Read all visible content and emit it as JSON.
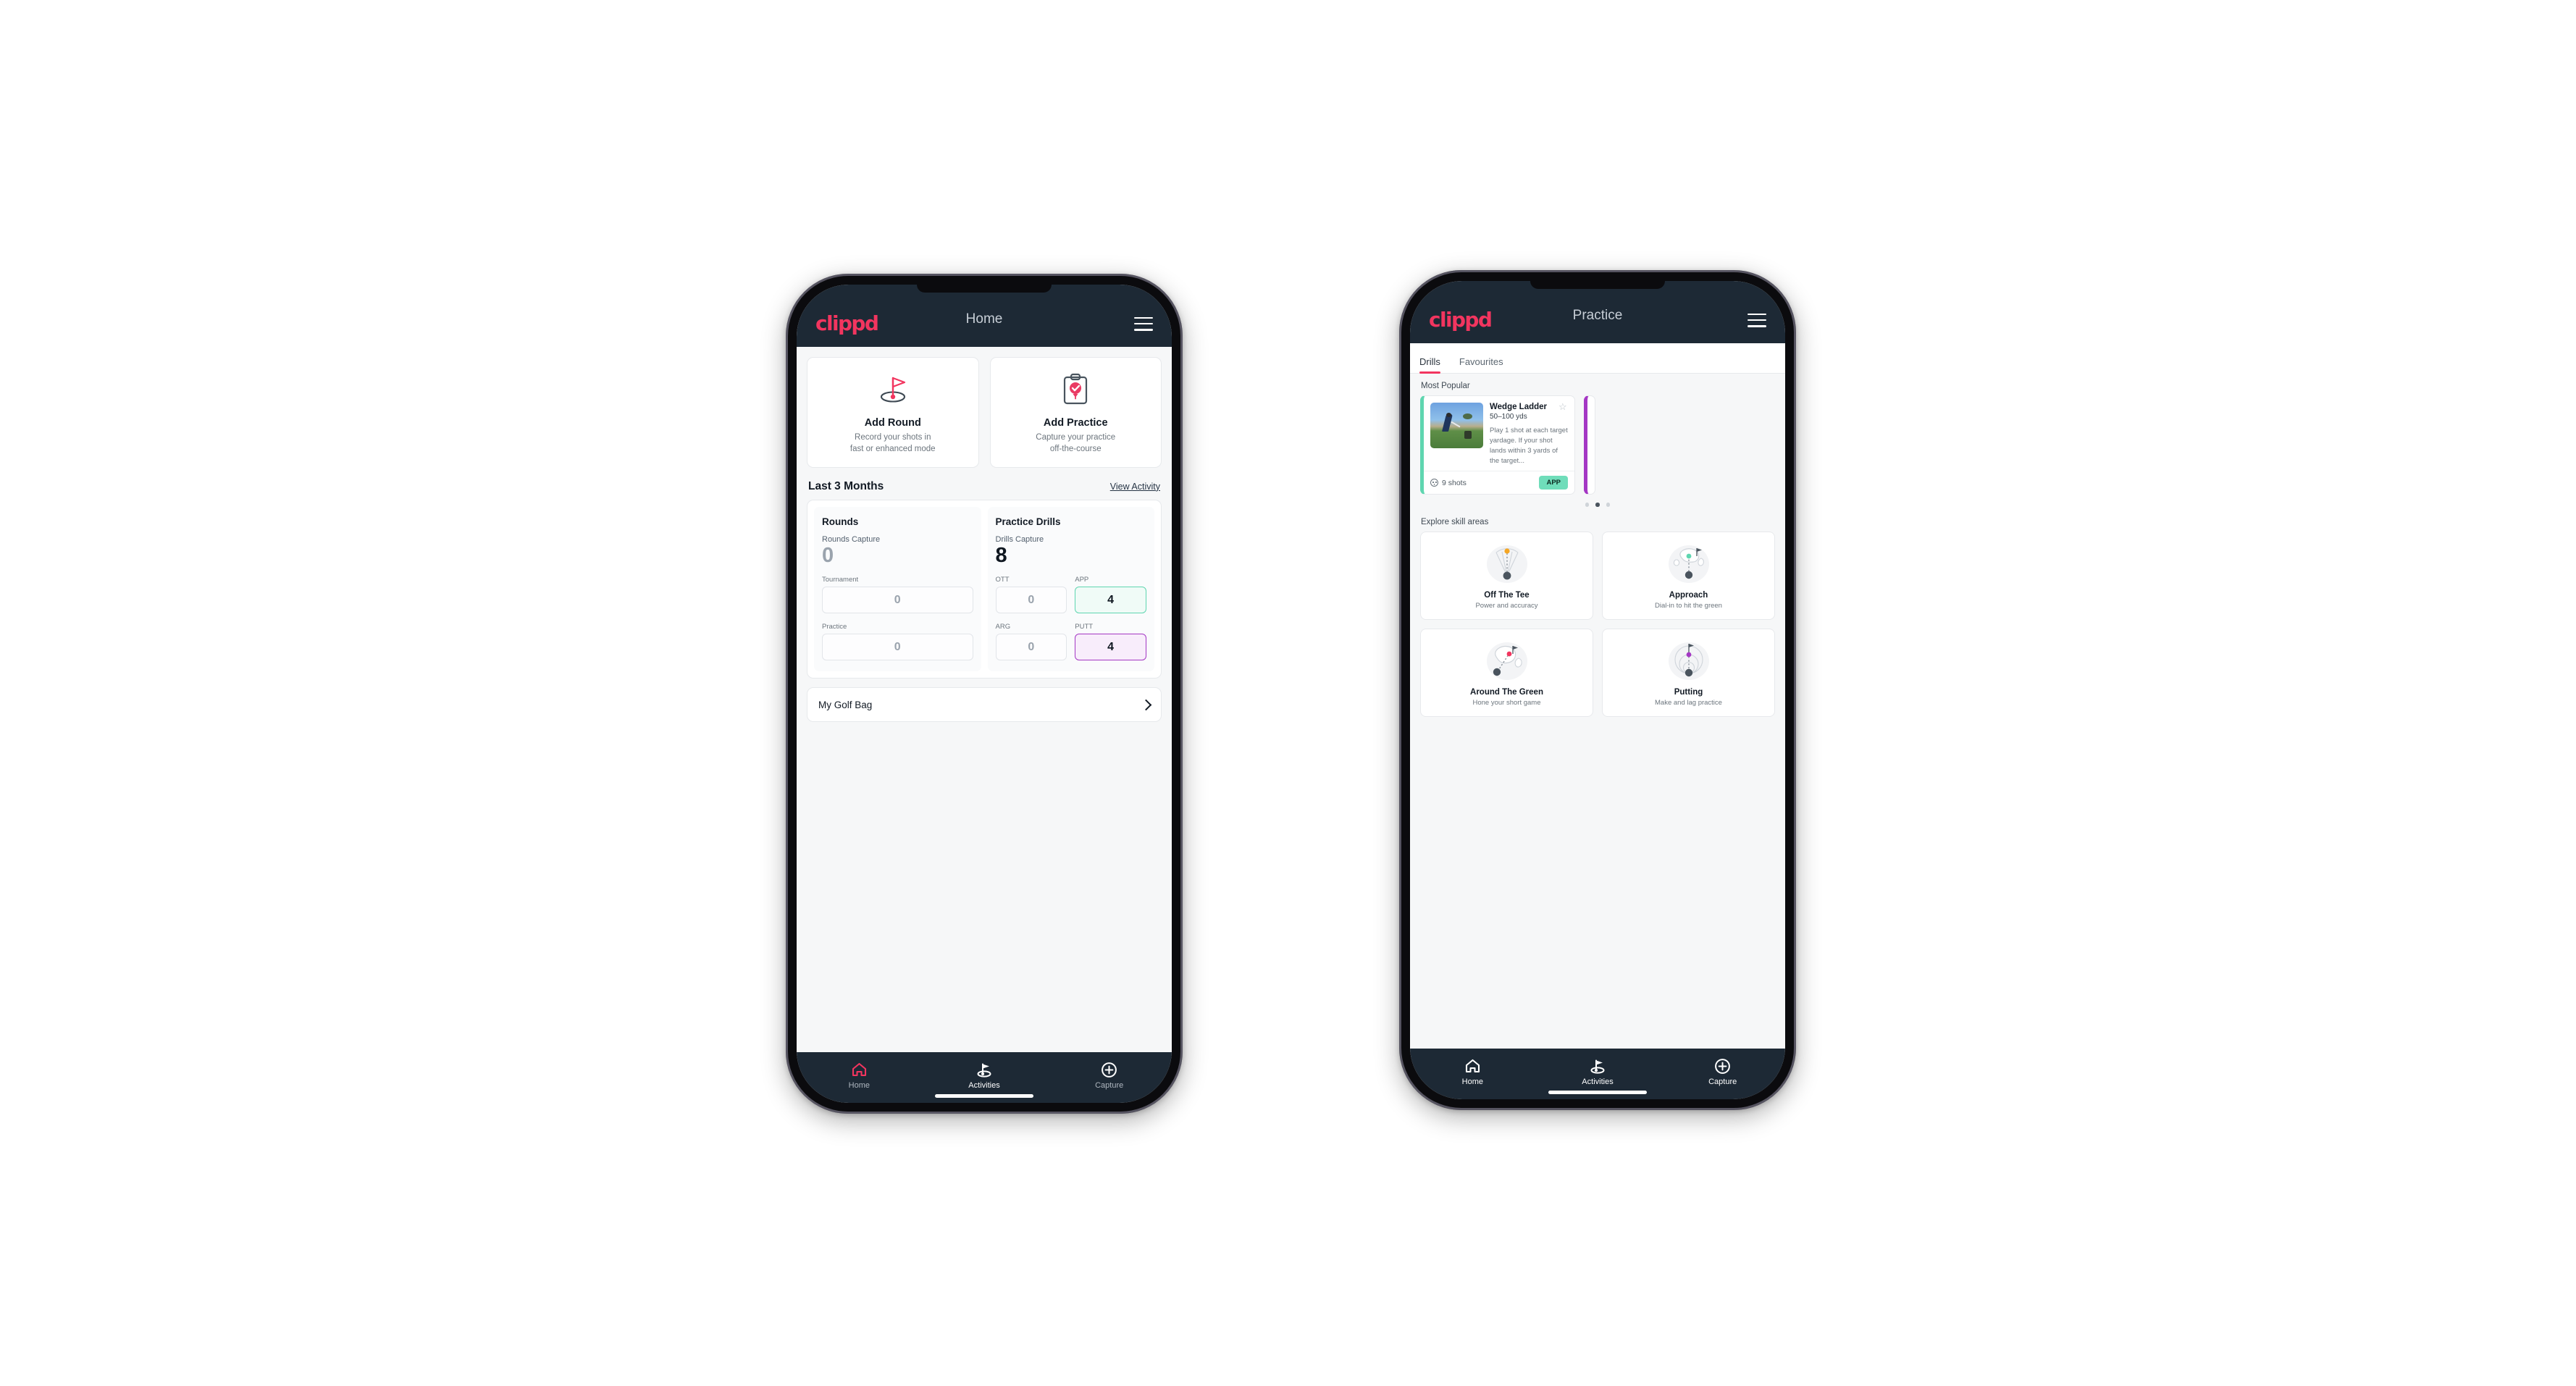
{
  "brand": {
    "logo_text": "clippd",
    "accent": "#f2355f",
    "dark": "#1d2935"
  },
  "phone_home": {
    "appbar": {
      "title": "Home",
      "menu_icon": "hamburger-icon"
    },
    "actions": [
      {
        "icon": "golf-flag-hole-icon",
        "title": "Add Round",
        "subtitle_line1": "Record your shots in",
        "subtitle_line2": "fast or enhanced mode"
      },
      {
        "icon": "clipboard-check-icon",
        "title": "Add Practice",
        "subtitle_line1": "Capture your practice",
        "subtitle_line2": "off-the-course"
      }
    ],
    "section": {
      "title": "Last 3 Months",
      "link": "View Activity"
    },
    "rounds": {
      "heading": "Rounds",
      "capture_label": "Rounds Capture",
      "capture_value": "0",
      "fields": [
        {
          "label": "Tournament",
          "value": "0",
          "style": "plain"
        },
        {
          "label": "Practice",
          "value": "0",
          "style": "plain"
        }
      ]
    },
    "drills": {
      "heading": "Practice Drills",
      "capture_label": "Drills Capture",
      "capture_value": "8",
      "fields": [
        {
          "label": "OTT",
          "value": "0",
          "style": "plain"
        },
        {
          "label": "APP",
          "value": "4",
          "style": "app"
        },
        {
          "label": "ARG",
          "value": "0",
          "style": "plain"
        },
        {
          "label": "PUTT",
          "value": "4",
          "style": "putt"
        }
      ]
    },
    "golf_bag": {
      "label": "My Golf Bag",
      "chevron": "chevron-right-icon"
    },
    "nav": [
      {
        "icon": "home-icon",
        "label": "Home",
        "active": true
      },
      {
        "icon": "golf-flag-icon",
        "label": "Activities",
        "active": false
      },
      {
        "icon": "plus-circle-icon",
        "label": "Capture",
        "active": false
      }
    ]
  },
  "phone_practice": {
    "appbar": {
      "title": "Practice",
      "menu_icon": "hamburger-icon"
    },
    "tabs": [
      {
        "label": "Drills",
        "active": true
      },
      {
        "label": "Favourites",
        "active": false
      }
    ],
    "most_popular_label": "Most Popular",
    "drill": {
      "name": "Wedge Ladder",
      "yardage": "50–100 yds",
      "description": "Play 1 shot at each target yardage. If your shot lands within 3 yards of the target...",
      "shots": "9 shots",
      "shots_icon": "golf-ball-icon",
      "badge": "APP",
      "badge_color": "#6fddba",
      "star_icon": "star-outline-icon",
      "accent": "#5fd6b0",
      "next_accent": "#a437c4"
    },
    "carousel_dots": {
      "count": 3,
      "active_index": 1
    },
    "skill_section_label": "Explore skill areas",
    "skills": [
      {
        "icon": "tee-shot-fan-icon",
        "name": "Off The Tee",
        "sub": "Power and accuracy",
        "dot_color": "#f5a623"
      },
      {
        "icon": "approach-green-icon",
        "name": "Approach",
        "sub": "Dial-in to hit the green",
        "dot_color": "#5fd6b0"
      },
      {
        "icon": "chip-green-icon",
        "name": "Around The Green",
        "sub": "Hone your short game",
        "dot_color": "#f2355f"
      },
      {
        "icon": "putting-rings-icon",
        "name": "Putting",
        "sub": "Make and lag practice",
        "dot_color": "#a437c4"
      }
    ],
    "nav": [
      {
        "icon": "home-icon",
        "label": "Home",
        "active": false
      },
      {
        "icon": "golf-flag-icon",
        "label": "Activities",
        "active": true
      },
      {
        "icon": "plus-circle-icon",
        "label": "Capture",
        "active": false
      }
    ]
  }
}
